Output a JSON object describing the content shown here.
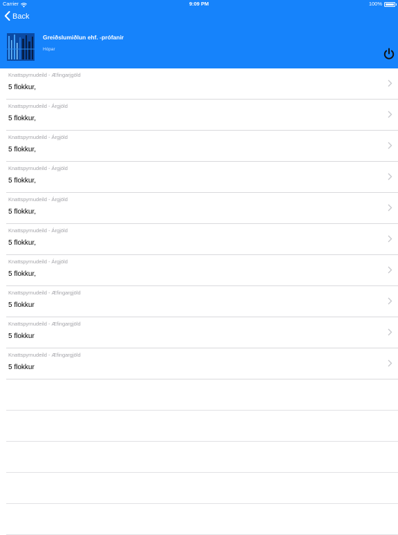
{
  "status_bar": {
    "carrier": "Carrier",
    "time": "9:09 PM",
    "battery": "100%"
  },
  "nav": {
    "back_label": "Back"
  },
  "header": {
    "company": "Greiðslumiðlun ehf. -prófanir",
    "subtitle": "Hópar"
  },
  "colors": {
    "header_background": "#1683fb",
    "separator": "#d9d9dc",
    "subtitle_text": "#a3a3a8",
    "chevron": "#c7c7cc"
  },
  "rows": [
    {
      "subtitle": "Knattspyrnudeild - Æfingarjgöld",
      "title": "5 flokkur,"
    },
    {
      "subtitle": "Knattspyrnudeild - Árgjöld",
      "title": "5 flokkur,"
    },
    {
      "subtitle": "Knattspyrnudeild - Árgjöld",
      "title": "5 flokkur,"
    },
    {
      "subtitle": "Knattspyrnudeild - Árgjöld",
      "title": "5 flokkur,"
    },
    {
      "subtitle": "Knattspyrnudeild - Árgjöld",
      "title": "5 flokkur,"
    },
    {
      "subtitle": "Knattspyrnudeild - Árgjöld",
      "title": "5 flokkur,"
    },
    {
      "subtitle": "Knattspyrnudeild - Árgjöld",
      "title": "5 flokkur,"
    },
    {
      "subtitle": "Knattspyrnudeild - Æfingargjöld",
      "title": "5 flokkur"
    },
    {
      "subtitle": "Knattspyrnudeild - Æfingargjöld",
      "title": "5 flokkur"
    },
    {
      "subtitle": "Knattspyrnudeild - Æfingargjöld",
      "title": "5 flokkur"
    }
  ],
  "icons": {
    "back": "chevron-left-icon",
    "power": "power-icon",
    "row_disclosure": "chevron-right-icon",
    "wifi": "wifi-icon",
    "battery": "battery-icon"
  }
}
